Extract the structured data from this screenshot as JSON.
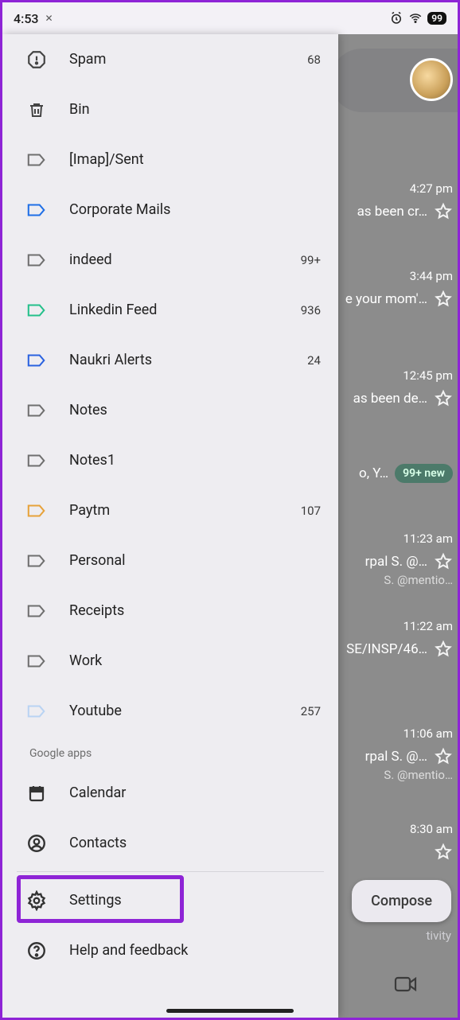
{
  "status": {
    "time": "4:53",
    "battery": "99"
  },
  "drawer": {
    "items": [
      {
        "label": "Spam",
        "count": "68",
        "icon": "spam"
      },
      {
        "label": "Bin",
        "count": "",
        "icon": "bin"
      },
      {
        "label": "[Imap]/Sent",
        "count": "",
        "icon": "label",
        "color": "#6f6f6f"
      },
      {
        "label": "Corporate Mails",
        "count": "",
        "icon": "label",
        "color": "#1f6fe6"
      },
      {
        "label": "indeed",
        "count": "99+",
        "icon": "label",
        "color": "#6f6f6f"
      },
      {
        "label": "Linkedin Feed",
        "count": "936",
        "icon": "label",
        "color": "#24c08a"
      },
      {
        "label": "Naukri Alerts",
        "count": "24",
        "icon": "label",
        "color": "#2a62e0"
      },
      {
        "label": "Notes",
        "count": "",
        "icon": "label",
        "color": "#6f6f6f"
      },
      {
        "label": "Notes1",
        "count": "",
        "icon": "label",
        "color": "#6f6f6f"
      },
      {
        "label": "Paytm",
        "count": "107",
        "icon": "label",
        "color": "#e7a23a"
      },
      {
        "label": "Personal",
        "count": "",
        "icon": "label",
        "color": "#6f6f6f"
      },
      {
        "label": "Receipts",
        "count": "",
        "icon": "label",
        "color": "#6f6f6f"
      },
      {
        "label": "Work",
        "count": "",
        "icon": "label",
        "color": "#6f6f6f"
      },
      {
        "label": "Youtube",
        "count": "257",
        "icon": "label",
        "color": "#b9d3f3"
      }
    ],
    "section": "Google apps",
    "apps": [
      {
        "label": "Calendar",
        "icon": "calendar"
      },
      {
        "label": "Contacts",
        "icon": "contacts"
      }
    ],
    "footer": [
      {
        "label": "Settings",
        "icon": "settings"
      },
      {
        "label": "Help and feedback",
        "icon": "help"
      }
    ]
  },
  "bg": {
    "rows": [
      {
        "time": "4:27 pm",
        "text": "as been cr…"
      },
      {
        "time": "3:44 pm",
        "text": "e your mom'…"
      },
      {
        "time": "12:45 pm",
        "text": "as been de…"
      },
      {
        "time": "",
        "text": "o, Y…",
        "badge": "99+ new"
      },
      {
        "time": "11:23 am",
        "text": "rpal S. @…",
        "sub": "S. @mentio…"
      },
      {
        "time": "11:22 am",
        "text": "SE/INSP/46…"
      },
      {
        "time": "11:06 am",
        "text": "rpal S. @…",
        "sub": "S. @mentio…"
      },
      {
        "time": "8:30 am",
        "text": ""
      }
    ],
    "compose": "Compose",
    "activity": "tivity"
  }
}
